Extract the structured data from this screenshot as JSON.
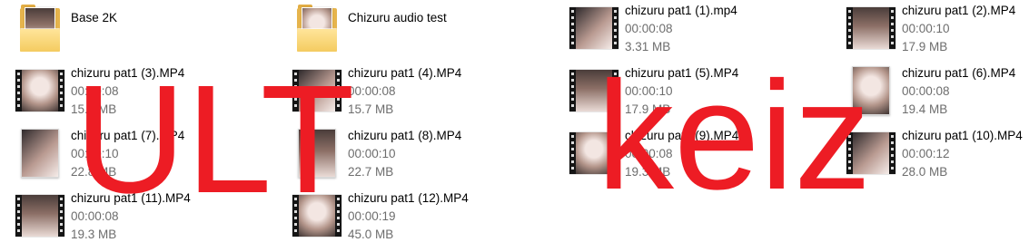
{
  "overlay": {
    "left_text": "ULT",
    "right_text": "keiz",
    "color": "#ED1C24"
  },
  "colors": {
    "background": "#FFFFFF",
    "name_text": "#000000",
    "detail_text": "#6D6D6D"
  },
  "items": [
    {
      "icon": "folder-icon",
      "name": "Base 2K"
    },
    {
      "icon": "folder-icon",
      "name": "Chizuru audio test"
    },
    {
      "icon": "video-thumbnail-icon",
      "name": "chizuru pat1 (1).mp4",
      "duration": "00:00:08",
      "size": "3.31 MB"
    },
    {
      "icon": "video-thumbnail-icon",
      "name": "chizuru pat1 (2).MP4",
      "duration": "00:00:10",
      "size": "17.9 MB"
    },
    {
      "icon": "video-thumbnail-icon",
      "name": "chizuru pat1 (3).MP4",
      "duration": "00:00:08",
      "size": "15.3 MB"
    },
    {
      "icon": "video-thumbnail-icon",
      "name": "chizuru pat1 (4).MP4",
      "duration": "00:00:08",
      "size": "15.7 MB"
    },
    {
      "icon": "video-thumbnail-icon",
      "name": "chizuru pat1 (5).MP4",
      "duration": "00:00:10",
      "size": "17.9 MB"
    },
    {
      "icon": "portrait-thumbnail-icon",
      "name": "chizuru pat1 (6).MP4",
      "duration": "00:00:08",
      "size": "19.4 MB"
    },
    {
      "icon": "portrait-thumbnail-icon",
      "name": "chizuru pat1 (7).MP4",
      "duration": "00:00:10",
      "size": "22.8 MB"
    },
    {
      "icon": "portrait-thumbnail-icon",
      "name": "chizuru pat1 (8).MP4",
      "duration": "00:00:10",
      "size": "22.7 MB"
    },
    {
      "icon": "video-thumbnail-icon",
      "name": "chizuru pat1 (9).MP4",
      "duration": "00:00:08",
      "size": "19.3 MB"
    },
    {
      "icon": "video-thumbnail-icon",
      "name": "chizuru pat1 (10).MP4",
      "duration": "00:00:12",
      "size": "28.0 MB"
    },
    {
      "icon": "video-thumbnail-icon",
      "name": "chizuru pat1 (11).MP4",
      "duration": "00:00:08",
      "size": "19.3 MB"
    },
    {
      "icon": "video-thumbnail-icon",
      "name": "chizuru pat1 (12).MP4",
      "duration": "00:00:19",
      "size": "45.0 MB"
    }
  ]
}
